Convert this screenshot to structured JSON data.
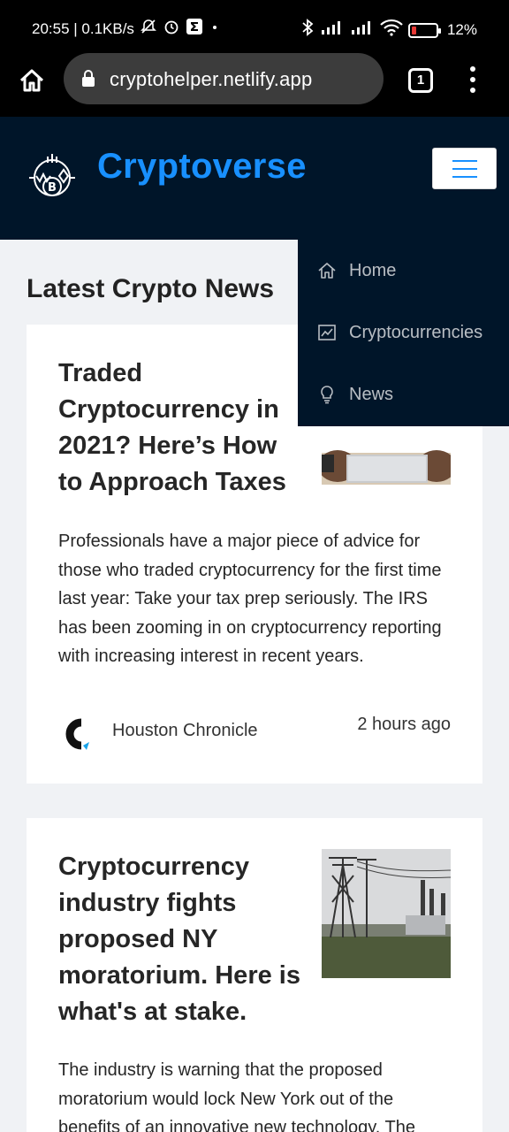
{
  "status_bar": {
    "time_and_speed": "20:55 | 0.1KB/s",
    "battery": "12%",
    "battery_level": 0.12
  },
  "browser": {
    "url": "cryptohelper.netlify.app",
    "tab_count": "1"
  },
  "header": {
    "brand": "Cryptoverse",
    "accent_color": "#1890ff",
    "header_bg": "#001529"
  },
  "menu": {
    "items": [
      {
        "label": "Home",
        "icon": "home-icon"
      },
      {
        "label": "Cryptocurrencies",
        "icon": "fund-chart-icon"
      },
      {
        "label": "News",
        "icon": "bulb-icon"
      }
    ]
  },
  "main": {
    "title": "Latest Crypto News",
    "articles": [
      {
        "title": "Traded Cryptocurrency in 2021? Here’s How to Approach Taxes",
        "description": "Professionals have a major piece of advice for those who traded cryptocurrency for the first time last year: Take your tax prep seriously. The IRS has been zooming in on cryptocurrency reporting with increasing interest in recent years.",
        "source": "Houston Chronicle",
        "time": "2 hours ago"
      },
      {
        "title": "Cryptocurrency industry fights proposed NY moratorium. Here is what's at stake.",
        "description": "The industry is warning that the proposed moratorium would lock New York out of the benefits of an innovative new technology. The"
      }
    ]
  }
}
